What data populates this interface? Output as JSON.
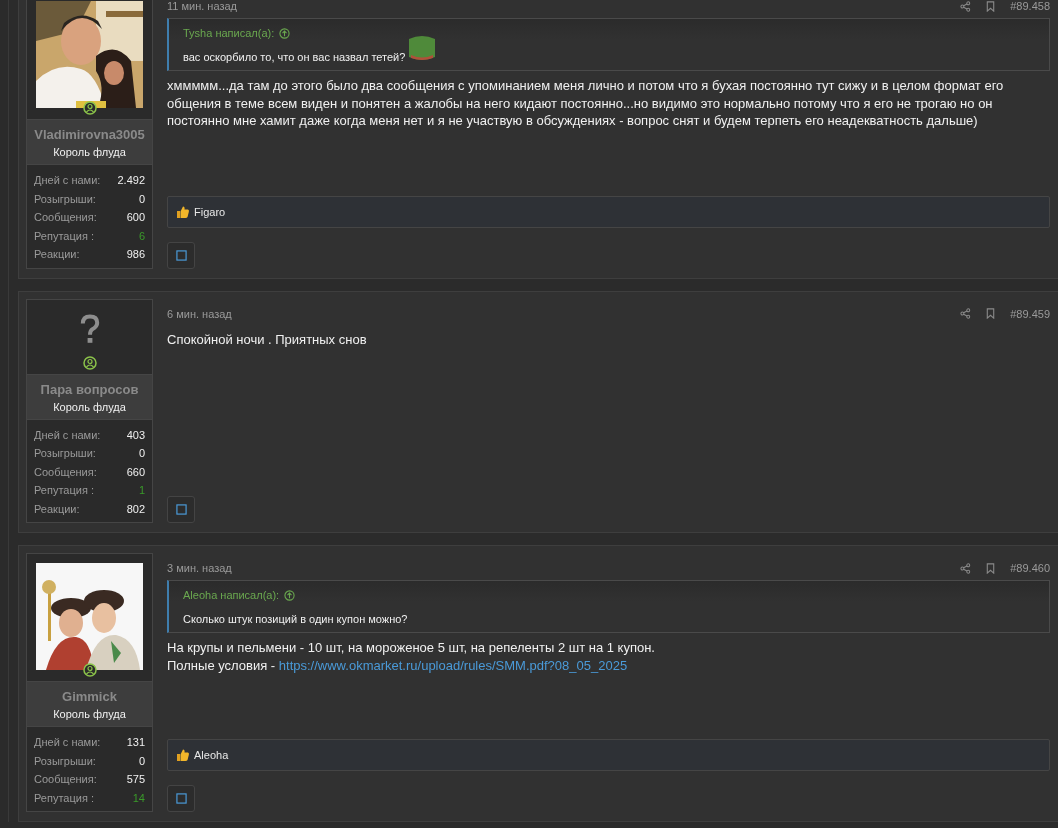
{
  "posts": [
    {
      "time": "11 мин. назад",
      "number": "#89.458",
      "user": {
        "name": "Vladimirovna3005",
        "rank": "Король флуда",
        "stats": [
          {
            "label": "Дней с нами:",
            "value": "2.492",
            "kind": "count"
          },
          {
            "label": "Розыгрыши:",
            "value": "0",
            "kind": "count"
          },
          {
            "label": "Сообщения:",
            "value": "600",
            "kind": "count"
          },
          {
            "label": "Репутация :",
            "value": "6",
            "kind": "reputation"
          },
          {
            "label": "Реакции:",
            "value": "986",
            "kind": "count"
          }
        ]
      },
      "quote": {
        "author": "Tysha написал(а):",
        "text": "вас оскорбило то, что он вас назвал тетей?",
        "sticker": true
      },
      "body": [
        {
          "text": "хммммм...да там до этого было два сообщения с упоминанием меня лично и потом что я бухая постоянно тут сижу и в целом формат его общения в теме всем виден и понятен а жалобы на него кидают постоянно...но видимо это нормально потому что я его не трогаю но он постоянно мне хамит даже когда меня нет и я не участвую в обсуждениях - вопрос снят и будем терпеть его неадекватность дальше)"
        }
      ],
      "reactions": "Figaro"
    },
    {
      "time": "6 мин. назад",
      "number": "#89.459",
      "user": {
        "avatar": {
          "kind": "placeholder"
        },
        "name": "Пара вопросов",
        "rank": "Король флуда",
        "stats": [
          {
            "label": "Дней с нами:",
            "value": "403",
            "kind": "count"
          },
          {
            "label": "Розыгрыши:",
            "value": "0",
            "kind": "count"
          },
          {
            "label": "Сообщения:",
            "value": "660",
            "kind": "count"
          },
          {
            "label": "Репутация :",
            "value": "1",
            "kind": "reputation"
          },
          {
            "label": "Реакции:",
            "value": "802",
            "kind": "count"
          }
        ]
      },
      "body": [
        {
          "text": "Спокойной ночи . Приятных снов"
        }
      ]
    },
    {
      "time": "3 мин. назад",
      "number": "#89.460",
      "user": {
        "name": "Gimmick",
        "rank": "Король флуда",
        "stats": [
          {
            "label": "Дней с нами:",
            "value": "131",
            "kind": "count"
          },
          {
            "label": "Розыгрыши:",
            "value": "0",
            "kind": "count"
          },
          {
            "label": "Сообщения:",
            "value": "575",
            "kind": "count"
          },
          {
            "label": "Репутация :",
            "value": "14",
            "kind": "reputation"
          }
        ]
      },
      "quote": {
        "author": "Aleoha написал(а):",
        "text": "Сколько штук позиций в один купон можно?",
        "sticker": false
      },
      "body": [
        {
          "text": "На крупы и пельмени - 10 шт, на мороженое 5 шт, на репеленты 2 шт на 1 купон."
        },
        {
          "text": "Полные условия - ",
          "link": "https://www.okmarket.ru/upload/rules/SMM.pdf?08_05_2025"
        }
      ],
      "reactions": "Aleoha"
    }
  ]
}
